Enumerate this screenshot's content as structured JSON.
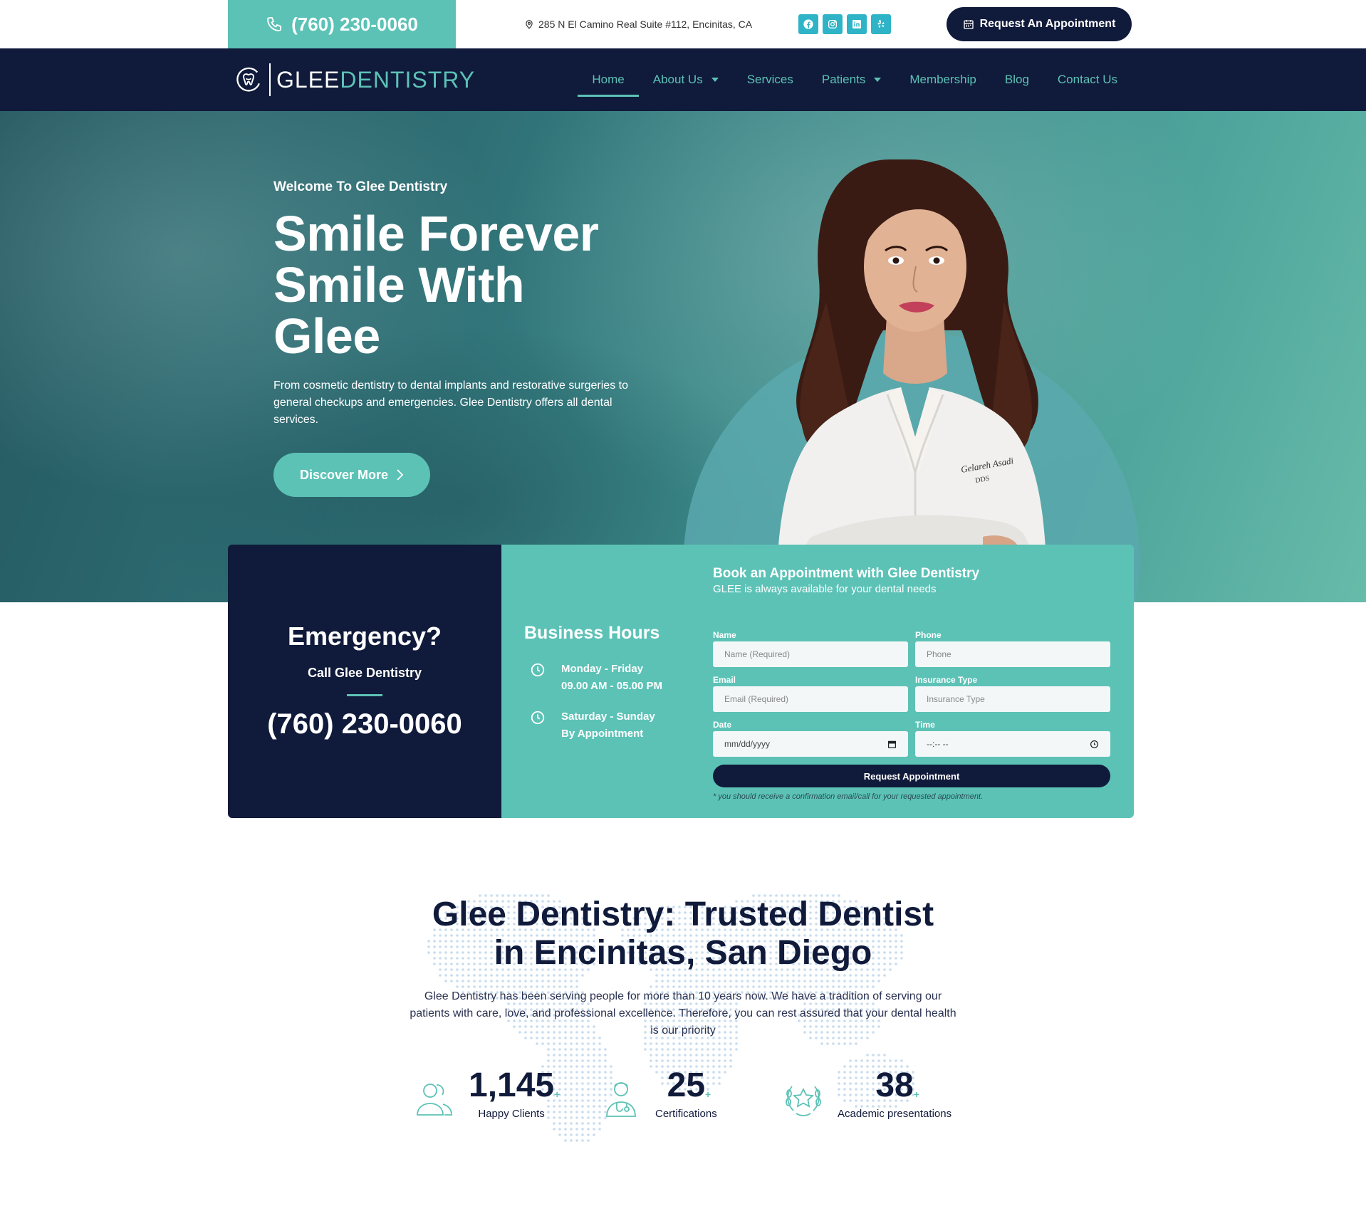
{
  "topbar": {
    "phone": "(760) 230-0060",
    "address": "285 N El Camino Real Suite #112, Encinitas, CA",
    "socials": [
      "facebook-icon",
      "instagram-icon",
      "linkedin-icon",
      "yelp-icon"
    ],
    "cta_label": "Request An Appointment"
  },
  "nav": {
    "logo_part1": "GLEE",
    "logo_part2": "DENTISTRY",
    "items": [
      {
        "label": "Home",
        "active": true,
        "dropdown": false
      },
      {
        "label": "About Us",
        "active": false,
        "dropdown": true
      },
      {
        "label": "Services",
        "active": false,
        "dropdown": false
      },
      {
        "label": "Patients",
        "active": false,
        "dropdown": true
      },
      {
        "label": "Membership",
        "active": false,
        "dropdown": false
      },
      {
        "label": "Blog",
        "active": false,
        "dropdown": false
      },
      {
        "label": "Contact Us",
        "active": false,
        "dropdown": false
      }
    ]
  },
  "hero": {
    "eyebrow": "Welcome To Glee Dentistry",
    "title_line1": "Smile Forever",
    "title_line2": "Smile With",
    "title_line3": "Glee",
    "description": "From cosmetic dentistry to dental implants and restorative surgeries to general checkups and emergencies. Glee Dentistry offers all dental services.",
    "button_label": "Discover More",
    "coat_name": "Gelareh Asadi",
    "coat_title": "DDS"
  },
  "emergency": {
    "title": "Emergency?",
    "subtitle": "Call Glee Dentistry",
    "phone": "(760) 230-0060"
  },
  "hours": {
    "title": "Business Hours",
    "rows": [
      {
        "line1": "Monday - Friday",
        "line2": "09.00 AM - 05.00 PM"
      },
      {
        "line1": "Saturday - Sunday",
        "line2": "By Appointment"
      }
    ]
  },
  "form": {
    "title": "Book an Appointment with Glee Dentistry",
    "subtitle": "GLEE is always available for your dental needs",
    "fields": {
      "name": {
        "label": "Name",
        "placeholder": "Name (Required)"
      },
      "phone": {
        "label": "Phone",
        "placeholder": "Phone"
      },
      "email": {
        "label": "Email",
        "placeholder": "Email (Required)"
      },
      "insurance": {
        "label": "Insurance Type",
        "placeholder": "Insurance Type"
      },
      "date": {
        "label": "Date",
        "placeholder": "mm/dd/yyyy"
      },
      "time": {
        "label": "Time",
        "placeholder": "--:-- --"
      }
    },
    "submit_label": "Request Appointment",
    "note": "* you should receive a confirmation email/call for your requested appointment."
  },
  "about": {
    "title_line1": "Glee Dentistry: Trusted Dentist",
    "title_line2": "in Encinitas, San Diego",
    "description": "Glee Dentistry has been serving people for more than 10 years now. We have a tradition of serving our patients with care, love, and professional excellence. Therefore, you can rest assured that your dental health is our priority",
    "stats": [
      {
        "value": "1,145",
        "suffix": "+",
        "label": "Happy Clients",
        "icon": "people-icon"
      },
      {
        "value": "25",
        "suffix": "+",
        "label": "Certifications",
        "icon": "doctor-icon"
      },
      {
        "value": "38",
        "suffix": "+",
        "label": "Academic presentations",
        "icon": "laurel-star-icon"
      }
    ]
  },
  "colors": {
    "navy": "#101a3a",
    "teal": "#5cc2b6",
    "social_blue": "#2eb3c7"
  }
}
